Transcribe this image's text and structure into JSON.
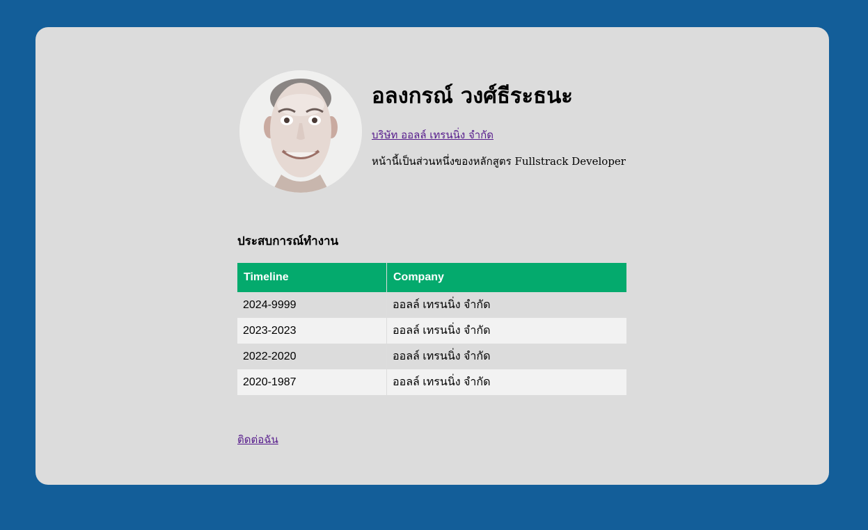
{
  "profile": {
    "name": "อลงกรณ์ วงศ์ธีระธนะ",
    "company_link": "บริษัท ออลล์ เทรนนิ่ง จำกัด",
    "description": "หน้านี้เป็นส่วนหนึ่งของหลักสูตร Fullstrack Developer"
  },
  "experience": {
    "title": "ประสบการณ์ทำงาน",
    "headers": [
      "Timeline",
      "Company"
    ],
    "rows": [
      {
        "timeline": "2024-9999",
        "company": "ออลล์ เทรนนิ่ง จำกัด"
      },
      {
        "timeline": "2023-2023",
        "company": "ออลล์ เทรนนิ่ง จำกัด"
      },
      {
        "timeline": "2022-2020",
        "company": "ออลล์ เทรนนิ่ง จำกัด"
      },
      {
        "timeline": "2020-1987",
        "company": "ออลล์ เทรนนิ่ง จำกัด"
      }
    ]
  },
  "contact_link": "ติดต่อฉัน",
  "colors": {
    "page_background": "#135e99",
    "card_background": "#dcdcdc",
    "table_header": "#04aa6d",
    "link": "#551a8b"
  }
}
